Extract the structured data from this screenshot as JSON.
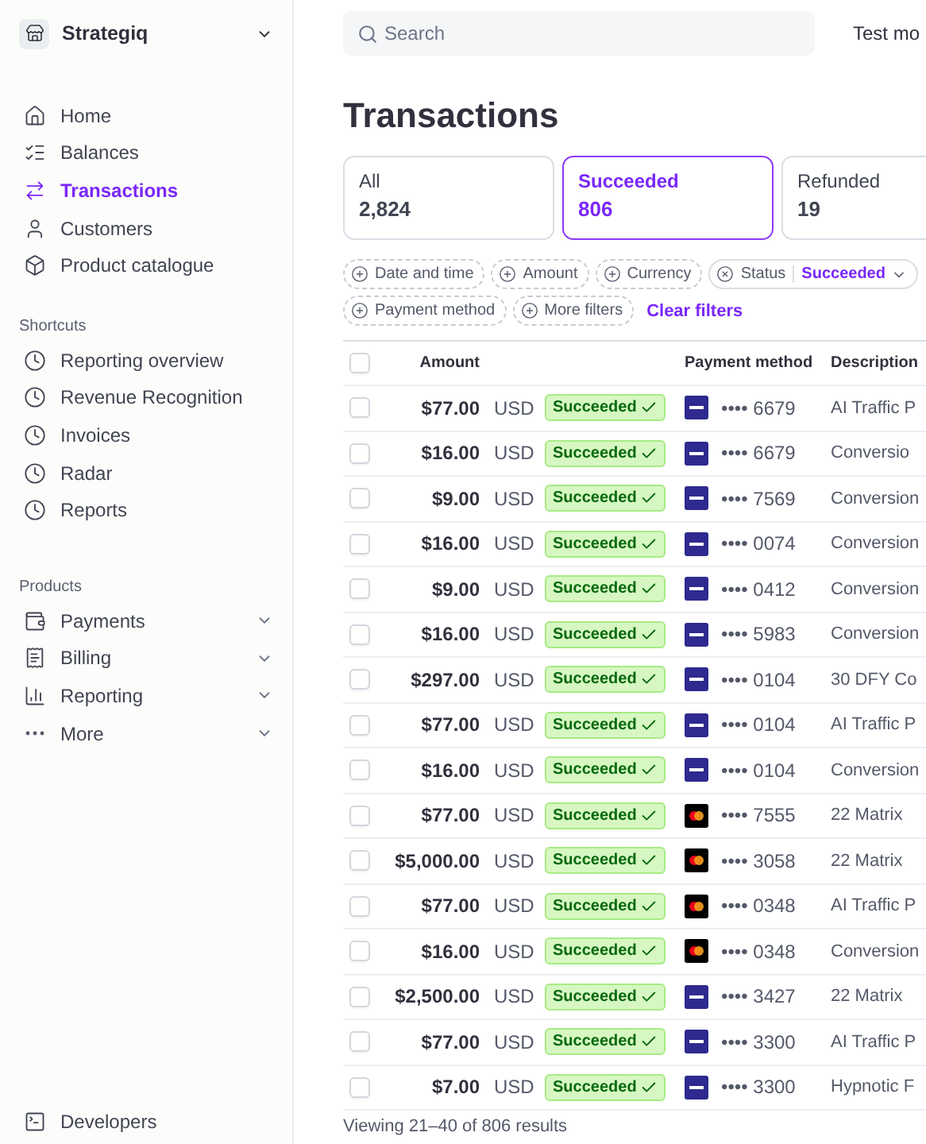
{
  "sidebar": {
    "brand": "Strategiq",
    "nav": [
      {
        "label": "Home",
        "selected": false
      },
      {
        "label": "Balances",
        "selected": false
      },
      {
        "label": "Transactions",
        "selected": true
      },
      {
        "label": "Customers",
        "selected": false
      },
      {
        "label": "Product catalogue",
        "selected": false
      }
    ],
    "sections": [
      {
        "title": "Shortcuts",
        "items": [
          {
            "label": "Reporting overview",
            "expandable": false
          },
          {
            "label": "Revenue Recognition",
            "expandable": false
          },
          {
            "label": "Invoices",
            "expandable": false
          },
          {
            "label": "Radar",
            "expandable": false
          },
          {
            "label": "Reports",
            "expandable": false
          }
        ]
      },
      {
        "title": "Products",
        "items": [
          {
            "label": "Payments",
            "expandable": true
          },
          {
            "label": "Billing",
            "expandable": true
          },
          {
            "label": "Reporting",
            "expandable": true
          },
          {
            "label": "More",
            "expandable": true
          }
        ]
      }
    ],
    "footer_item": {
      "label": "Developers"
    }
  },
  "topbar": {
    "search": {
      "placeholder": "Search"
    },
    "mode_label": "Test mo"
  },
  "title": "Transactions",
  "tabs": [
    {
      "label": "All",
      "count": "2,824",
      "selected": false
    },
    {
      "label": "Succeeded",
      "count": "806",
      "selected": true
    },
    {
      "label": "Refunded",
      "count": "19",
      "selected": false
    }
  ],
  "filters": [
    {
      "kind": "add",
      "label": "Date and time"
    },
    {
      "kind": "add",
      "label": "Amount"
    },
    {
      "kind": "add",
      "label": "Currency"
    },
    {
      "kind": "applied",
      "label": "Status",
      "value": "Succeeded"
    },
    {
      "kind": "add",
      "label": "Payment method"
    },
    {
      "kind": "add",
      "label": "More filters"
    }
  ],
  "clear_filters": "Clear filters",
  "table": {
    "select_all_checked": false,
    "columns": {
      "amount": "Amount",
      "payment_method": "Payment method",
      "description": "Description"
    },
    "rows": [
      {
        "kind": "visa",
        "checked": false,
        "amount": "$77.00",
        "currency": "USD",
        "status": "Succeeded",
        "last4": "•••• 6679",
        "description": "AI Traffic P"
      },
      {
        "kind": "visa",
        "checked": false,
        "amount": "$16.00",
        "currency": "USD",
        "status": "Succeeded",
        "last4": "•••• 6679",
        "description": "Conversio"
      },
      {
        "kind": "visa",
        "checked": false,
        "amount": "$9.00",
        "currency": "USD",
        "status": "Succeeded",
        "last4": "•••• 7569",
        "description": "Conversion"
      },
      {
        "kind": "visa",
        "checked": false,
        "amount": "$16.00",
        "currency": "USD",
        "status": "Succeeded",
        "last4": "•••• 0074",
        "description": "Conversion"
      },
      {
        "kind": "visa",
        "checked": false,
        "amount": "$9.00",
        "currency": "USD",
        "status": "Succeeded",
        "last4": "•••• 0412",
        "description": "Conversion"
      },
      {
        "kind": "visa",
        "checked": false,
        "amount": "$16.00",
        "currency": "USD",
        "status": "Succeeded",
        "last4": "•••• 5983",
        "description": "Conversion"
      },
      {
        "kind": "visa",
        "checked": false,
        "amount": "$297.00",
        "currency": "USD",
        "status": "Succeeded",
        "last4": "•••• 0104",
        "description": "30 DFY Co"
      },
      {
        "kind": "visa",
        "checked": false,
        "amount": "$77.00",
        "currency": "USD",
        "status": "Succeeded",
        "last4": "•••• 0104",
        "description": "AI Traffic P"
      },
      {
        "kind": "visa",
        "checked": false,
        "amount": "$16.00",
        "currency": "USD",
        "status": "Succeeded",
        "last4": "•••• 0104",
        "description": "Conversion"
      },
      {
        "kind": "mastercard",
        "checked": false,
        "amount": "$77.00",
        "currency": "USD",
        "status": "Succeeded",
        "last4": "•••• 7555",
        "description": "22 Matrix"
      },
      {
        "kind": "mastercard",
        "checked": false,
        "amount": "$5,000.00",
        "currency": "USD",
        "status": "Succeeded",
        "last4": "•••• 3058",
        "description": "22 Matrix"
      },
      {
        "kind": "mastercard",
        "checked": false,
        "amount": "$77.00",
        "currency": "USD",
        "status": "Succeeded",
        "last4": "•••• 0348",
        "description": "AI Traffic P"
      },
      {
        "kind": "mastercard",
        "checked": false,
        "amount": "$16.00",
        "currency": "USD",
        "status": "Succeeded",
        "last4": "•••• 0348",
        "description": "Conversion"
      },
      {
        "kind": "visa",
        "checked": false,
        "amount": "$2,500.00",
        "currency": "USD",
        "status": "Succeeded",
        "last4": "•••• 3427",
        "description": "22 Matrix"
      },
      {
        "kind": "visa",
        "checked": false,
        "amount": "$77.00",
        "currency": "USD",
        "status": "Succeeded",
        "last4": "•••• 3300",
        "description": "AI Traffic P"
      },
      {
        "kind": "visa",
        "checked": false,
        "amount": "$7.00",
        "currency": "USD",
        "status": "Succeeded",
        "last4": "•••• 3300",
        "description": "Hypnotic F"
      }
    ]
  },
  "footer": "Viewing 21–40 of 806 results"
}
